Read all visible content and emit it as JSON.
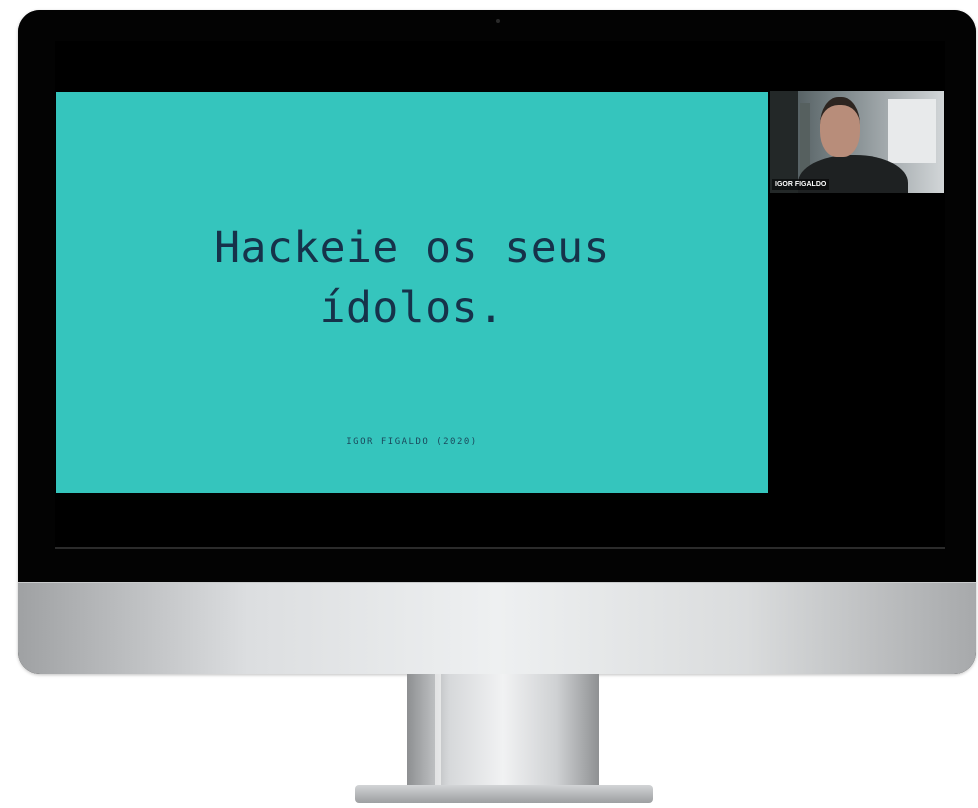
{
  "slide": {
    "title_line1": "Hackeie os seus",
    "title_line2": "ídolos.",
    "footer": "IGOR FIGALDO (2020)",
    "background_color": "#35c5bd",
    "text_color": "#16324a"
  },
  "participant": {
    "name": "IGOR FIGALDO"
  }
}
